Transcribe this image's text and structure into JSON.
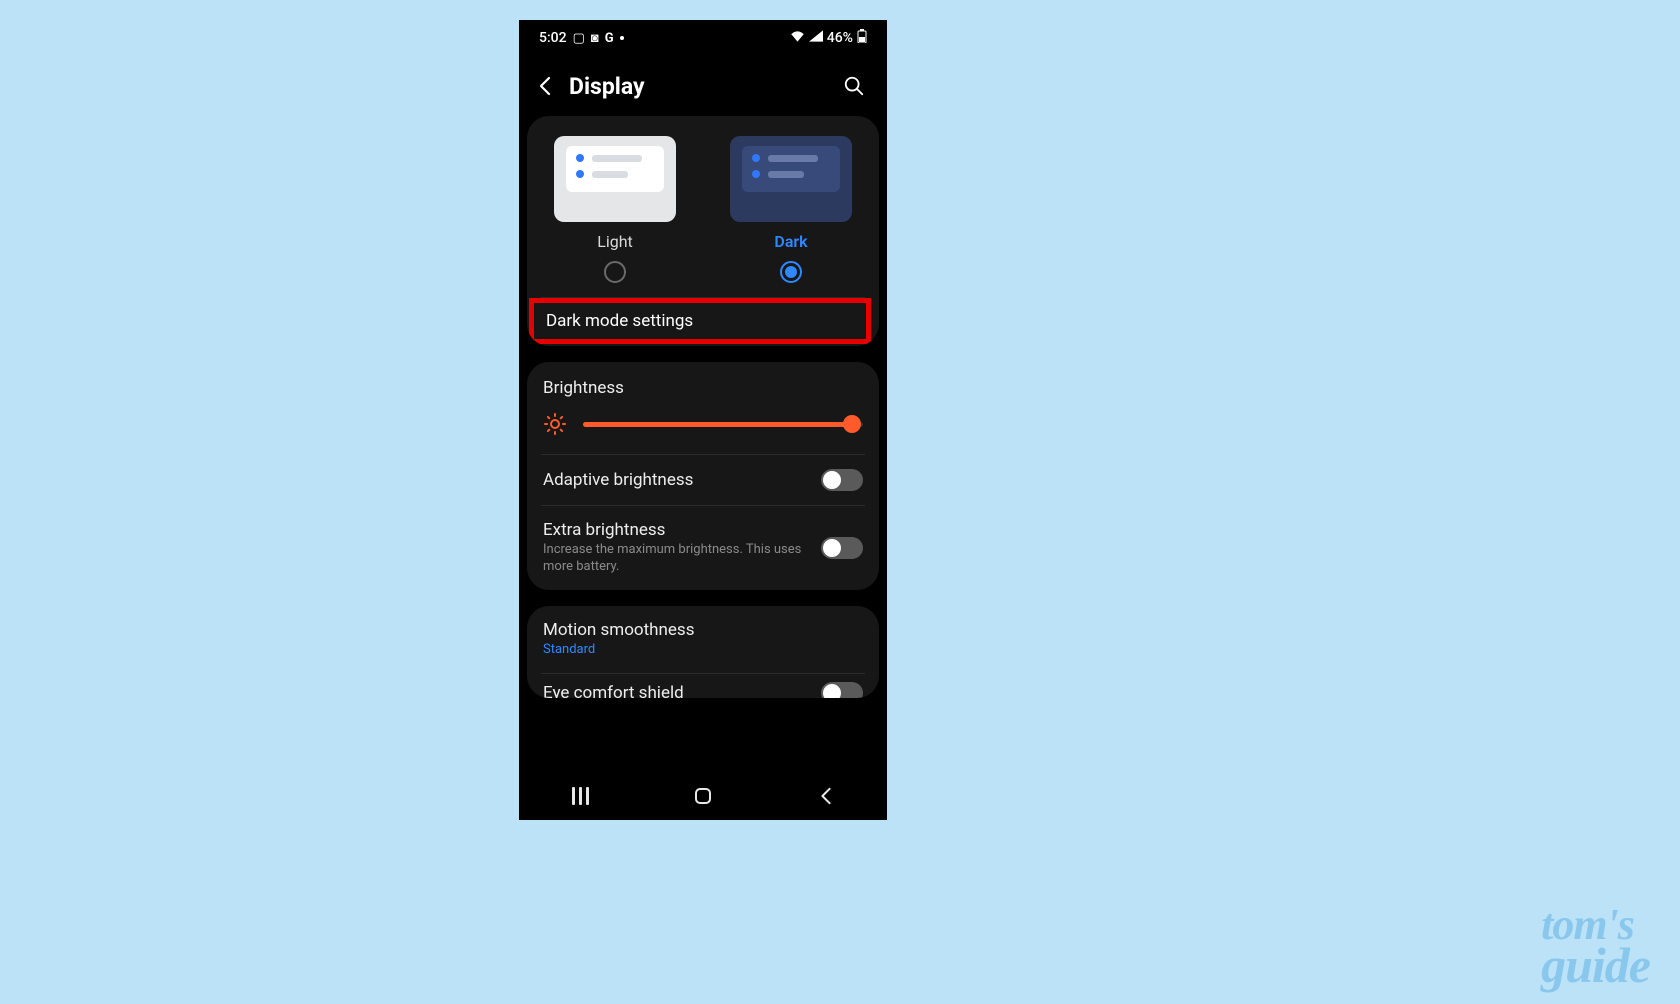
{
  "statusbar": {
    "time": "5:02",
    "battery_text": "46%",
    "icons_left": [
      "image-icon",
      "screenshot-icon",
      "google-icon",
      "more-dot"
    ],
    "icons_right": [
      "wifi-icon",
      "signal-icon"
    ]
  },
  "appbar": {
    "title": "Display"
  },
  "theme": {
    "light_label": "Light",
    "dark_label": "Dark",
    "selected": "dark"
  },
  "dark_mode_settings_label": "Dark mode settings",
  "brightness": {
    "label": "Brightness",
    "value_percent": 96
  },
  "adaptive_brightness": {
    "label": "Adaptive brightness",
    "enabled": false
  },
  "extra_brightness": {
    "label": "Extra brightness",
    "sub": "Increase the maximum brightness. This uses more battery.",
    "enabled": false
  },
  "motion_smoothness": {
    "label": "Motion smoothness",
    "value": "Standard"
  },
  "peek_item": {
    "label": "Eye comfort shield"
  },
  "colors": {
    "accent_blue": "#2f88ff",
    "accent_orange": "#ff5a2b",
    "highlight_red": "#e60000"
  },
  "watermark": {
    "line1": "tom's",
    "line2": "guide"
  }
}
